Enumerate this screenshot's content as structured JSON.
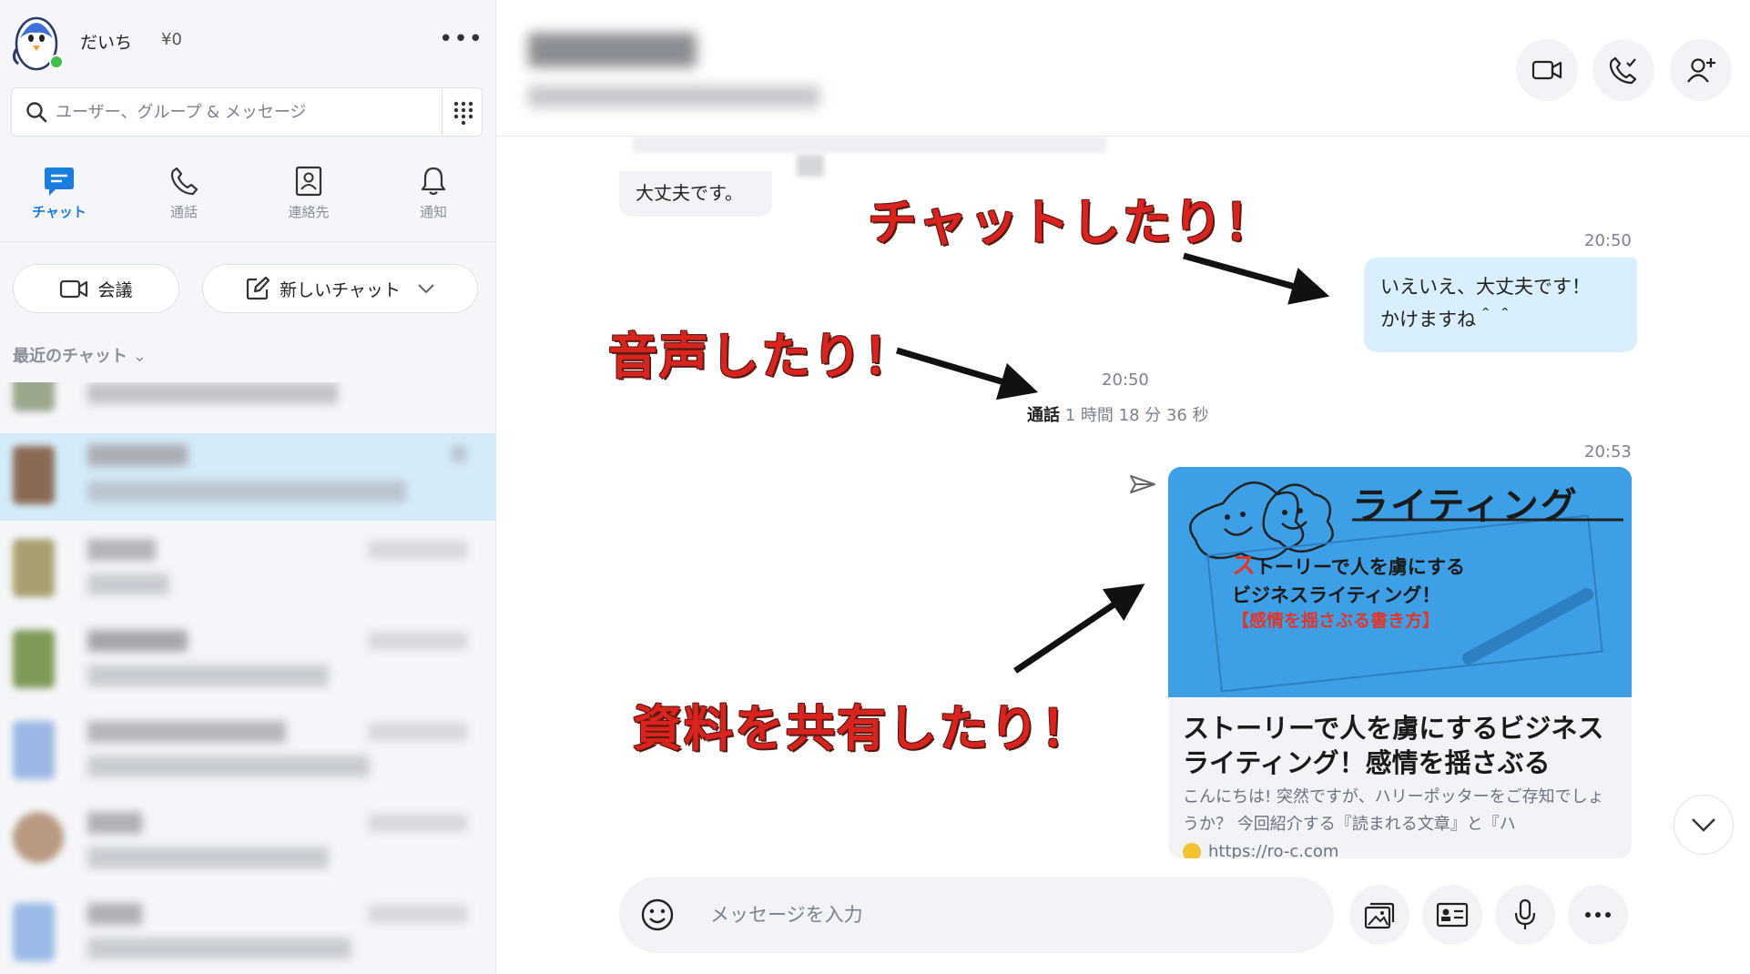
{
  "sidebar": {
    "profile": {
      "name": "だいち",
      "credit": "¥0",
      "more_label": "•••"
    },
    "search": {
      "placeholder": "ユーザー、グループ & メッセージ"
    },
    "nav": [
      {
        "label": "チャット",
        "icon": "chat-icon",
        "active": true
      },
      {
        "label": "通話",
        "icon": "phone-icon",
        "active": false
      },
      {
        "label": "連絡先",
        "icon": "contacts-icon",
        "active": false
      },
      {
        "label": "通知",
        "icon": "bell-icon",
        "active": false
      }
    ],
    "actions": {
      "meeting_label": "会議",
      "new_chat_label": "新しいチャット"
    },
    "recent_header": "最近のチャット"
  },
  "chat": {
    "old_message": "大丈夫です。",
    "messages": {
      "mine_time": "20:50",
      "mine_line1": "いえいえ、大丈夫です！",
      "mine_line2": "かけますね＾＾",
      "call_time": "20:50",
      "call_label": "通話",
      "call_duration": "1 時間 18 分 36 秒",
      "card_time": "20:53"
    },
    "card": {
      "image_heading": "ライティング",
      "image_line1_accent": "ス",
      "image_line1": "トーリーで人を虜にする",
      "image_line2": "ビジネスライティング！",
      "image_line3": "【感情を揺さぶる書き方】",
      "title": "ストーリーで人を虜にするビジネスライティング！感情を揺さぶる",
      "description": "こんにちは! 突然ですが、ハリーポッターをご存知でしょうか？ 今回紹介する『読まれる文章』と『ハ",
      "url": "https://ro-c.com"
    },
    "composer": {
      "placeholder": "メッセージを入力"
    }
  },
  "annotations": {
    "chat": "チャットしたり！",
    "voice": "音声したり！",
    "share": "資料を共有したり！"
  },
  "colors": {
    "accent": "#1a7de0",
    "bubble_mine": "#d9f0fc",
    "annotation": "#d8231e",
    "selected_row": "#d6ebf8"
  }
}
